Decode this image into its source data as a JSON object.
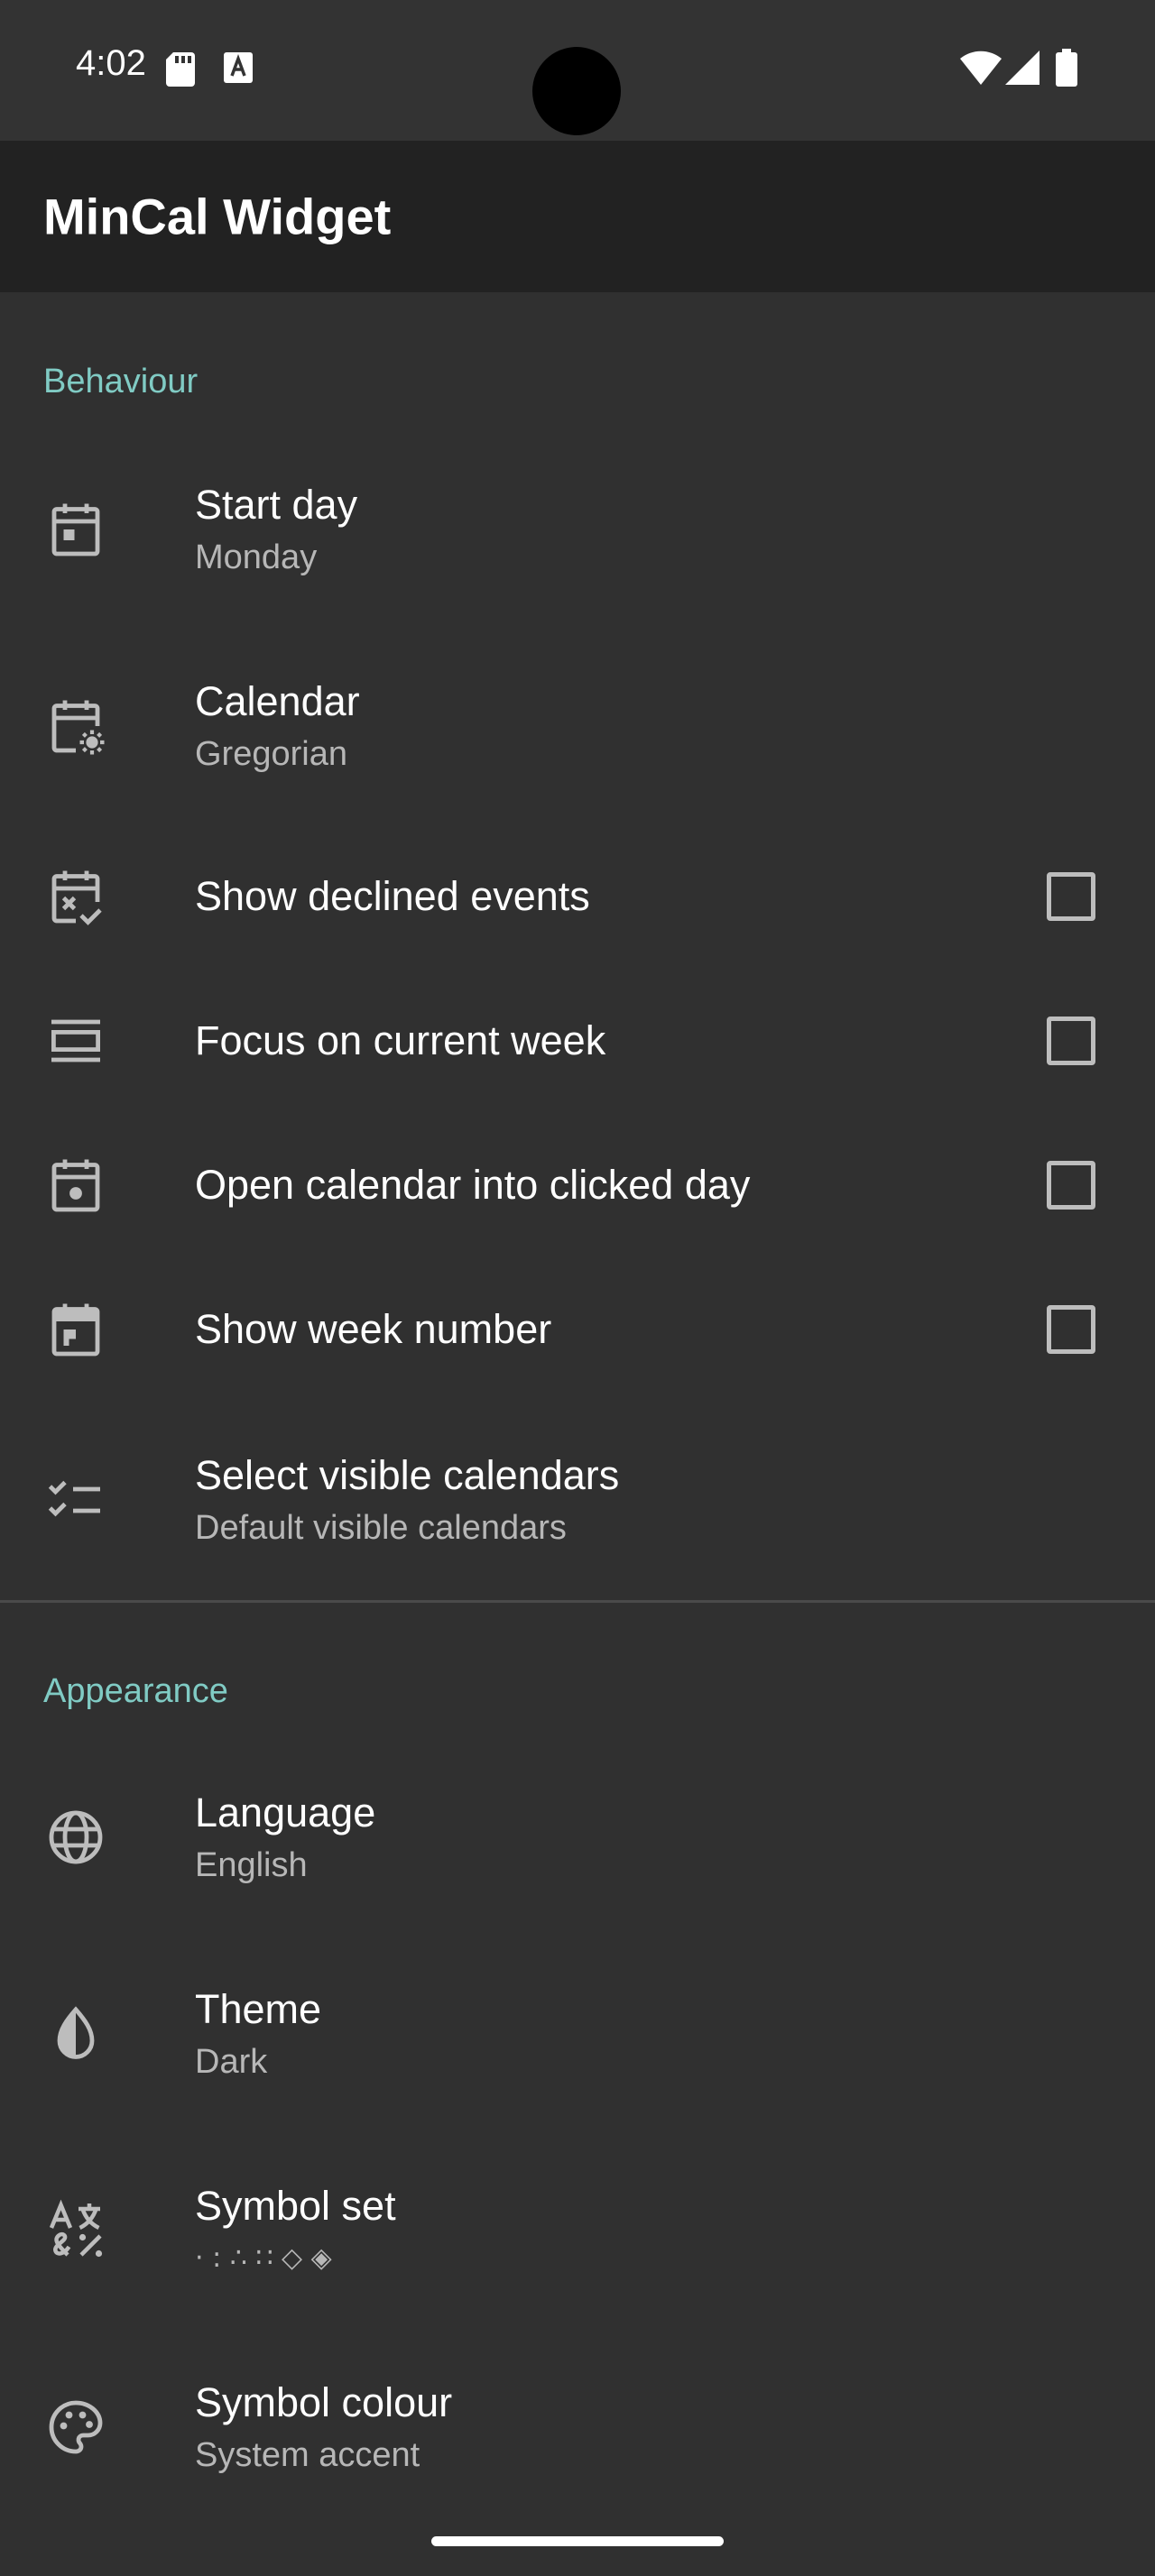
{
  "status_bar": {
    "time": "4:02",
    "left_icons": [
      "sd-card-icon",
      "font-download-icon"
    ],
    "right_icons": [
      "wifi-icon",
      "signal-icon",
      "battery-icon"
    ]
  },
  "app_bar": {
    "title": "MinCal Widget"
  },
  "colors": {
    "accent": "#80cbc4",
    "background": "#303030",
    "appbar": "#222222"
  },
  "behaviour": {
    "header": "Behaviour",
    "start_day": {
      "title": "Start day",
      "summary": "Monday",
      "icon": "calendar-today-icon"
    },
    "calendar": {
      "title": "Calendar",
      "summary": "Gregorian",
      "icon": "calendar-settings-icon"
    },
    "show_declined": {
      "title": "Show declined events",
      "checked": false,
      "icon": "calendar-declined-icon"
    },
    "focus_week": {
      "title": "Focus on current week",
      "checked": false,
      "icon": "view-week-icon"
    },
    "open_clicked_day": {
      "title": "Open calendar into clicked day",
      "checked": false,
      "icon": "event-icon"
    },
    "show_week_number": {
      "title": "Show week number",
      "checked": false,
      "icon": "calendar-week-number-icon"
    },
    "visible_calendars": {
      "title": "Select visible calendars",
      "summary": "Default visible calendars",
      "icon": "checklist-icon"
    }
  },
  "appearance": {
    "header": "Appearance",
    "language": {
      "title": "Language",
      "summary": "English",
      "icon": "globe-icon"
    },
    "theme": {
      "title": "Theme",
      "summary": "Dark",
      "icon": "contrast-icon"
    },
    "symbol_set": {
      "title": "Symbol set",
      "summary": "· : ∴ ∷ ◇ ◈",
      "icon": "translate-symbols-icon"
    },
    "symbol_colour": {
      "title": "Symbol colour",
      "summary": "System accent",
      "icon": "palette-icon"
    }
  }
}
